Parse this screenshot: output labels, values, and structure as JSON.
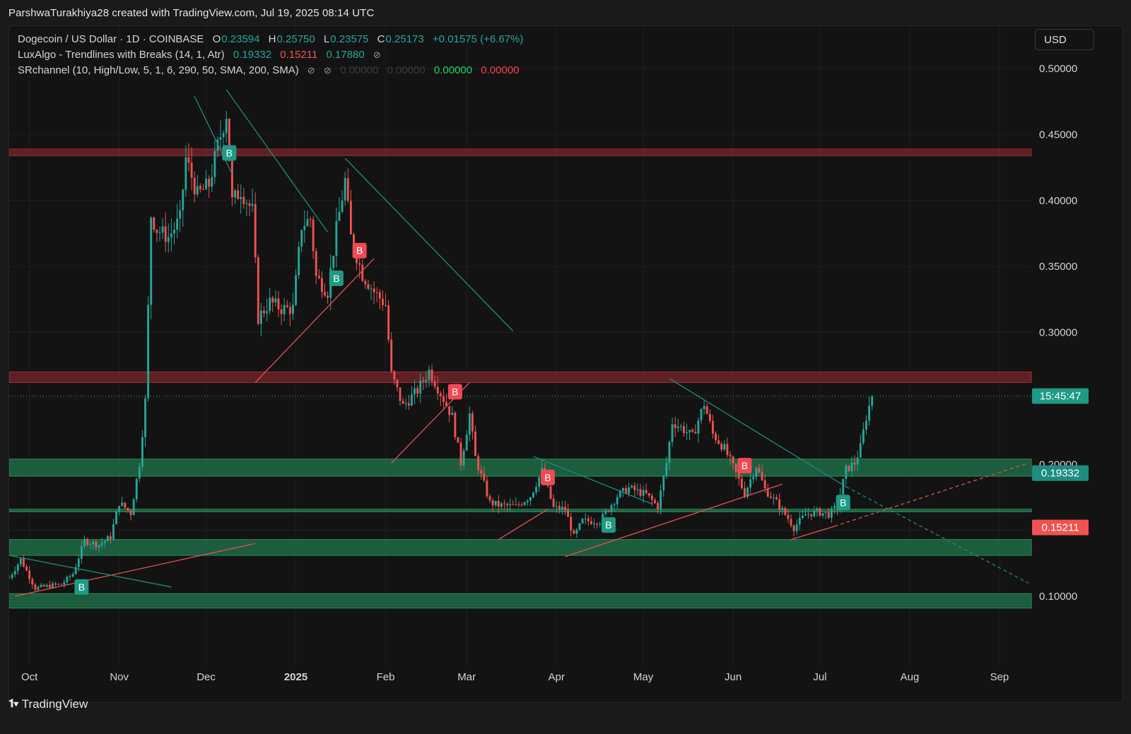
{
  "header": {
    "credit": "ParshwaTurakhiya28 created with TradingView.com, Jul 19, 2025 08:14 UTC"
  },
  "legend": {
    "symbol": "Dogecoin / US Dollar · 1D · COINBASE",
    "open_label": "O",
    "open": "0.23594",
    "high_label": "H",
    "high": "0.25750",
    "low_label": "L",
    "low": "0.23575",
    "close_label": "C",
    "close": "0.25173",
    "change": "+0.01575 (+6.67%)",
    "luxalgo_name": "LuxAlgo - Trendlines with Breaks (14, 1, Atr)",
    "luxalgo_v1": "0.19332",
    "luxalgo_v2": "0.15211",
    "luxalgo_v3": "0.17880",
    "srchannel_name": "SRchannel (10, High/Low, 5, 1, 6, 290, 50, SMA, 200, SMA)",
    "sr_v1": "0.00000",
    "sr_v2": "0.00000",
    "sr_v3": "0.00000",
    "sr_v4": "0.00000",
    "hidden_icon": "eye-off-icon"
  },
  "currency": "USD",
  "footer": {
    "brand": "TradingView",
    "brand_icon": "tradingview-logo-icon"
  },
  "colors": {
    "bg": "#131313",
    "up": "#26a69a",
    "down": "#ef5350",
    "green_zone": "#1f6b45",
    "red_zone": "#6b2328",
    "trend_teal": "#1e8c80"
  },
  "chart_data": {
    "type": "candlestick",
    "symbol": "DOGE/USD",
    "interval": "1D",
    "ylim": [
      0.055,
      0.5
    ],
    "y_ticks": [
      "0.10000",
      "0.15000",
      "0.20000",
      "0.25000",
      "0.30000",
      "0.35000",
      "0.40000",
      "0.45000",
      "0.50000"
    ],
    "x_labels": [
      {
        "label": "Oct",
        "date": "2024-10-01",
        "bold": false
      },
      {
        "label": "Nov",
        "date": "2024-11-01",
        "bold": false
      },
      {
        "label": "Dec",
        "date": "2024-12-01",
        "bold": false
      },
      {
        "label": "2025",
        "date": "2025-01-01",
        "bold": true
      },
      {
        "label": "Feb",
        "date": "2025-02-01",
        "bold": false
      },
      {
        "label": "Mar",
        "date": "2025-03-01",
        "bold": false
      },
      {
        "label": "Apr",
        "date": "2025-04-01",
        "bold": false
      },
      {
        "label": "May",
        "date": "2025-05-01",
        "bold": false
      },
      {
        "label": "Jun",
        "date": "2025-06-01",
        "bold": false
      },
      {
        "label": "Jul",
        "date": "2025-07-01",
        "bold": false
      },
      {
        "label": "Aug",
        "date": "2025-08-01",
        "bold": false
      },
      {
        "label": "Sep",
        "date": "2025-09-01",
        "bold": false
      }
    ],
    "x_range": [
      "2024-09-24",
      "2025-09-12"
    ],
    "last_close": 0.25173,
    "countdown": "15:45:47",
    "price_labels": [
      {
        "value": 0.19332,
        "text": "0.19332",
        "color": "#1e8c80"
      },
      {
        "value": 0.15211,
        "text": "0.15211",
        "color": "#ef5350"
      }
    ],
    "close_series": [
      {
        "date": "2024-09-24",
        "close": 0.114
      },
      {
        "date": "2024-09-28",
        "close": 0.128
      },
      {
        "date": "2024-10-03",
        "close": 0.106
      },
      {
        "date": "2024-10-08",
        "close": 0.108
      },
      {
        "date": "2024-10-12",
        "close": 0.109
      },
      {
        "date": "2024-10-16",
        "close": 0.117
      },
      {
        "date": "2024-10-20",
        "close": 0.142
      },
      {
        "date": "2024-10-25",
        "close": 0.139
      },
      {
        "date": "2024-10-29",
        "close": 0.145
      },
      {
        "date": "2024-11-01",
        "close": 0.171
      },
      {
        "date": "2024-11-05",
        "close": 0.163
      },
      {
        "date": "2024-11-08",
        "close": 0.201
      },
      {
        "date": "2024-11-10",
        "close": 0.248
      },
      {
        "date": "2024-11-12",
        "close": 0.389
      },
      {
        "date": "2024-11-14",
        "close": 0.378
      },
      {
        "date": "2024-11-18",
        "close": 0.372
      },
      {
        "date": "2024-11-22",
        "close": 0.386
      },
      {
        "date": "2024-11-24",
        "close": 0.432
      },
      {
        "date": "2024-11-28",
        "close": 0.404
      },
      {
        "date": "2024-12-02",
        "close": 0.412
      },
      {
        "date": "2024-12-05",
        "close": 0.441
      },
      {
        "date": "2024-12-08",
        "close": 0.466
      },
      {
        "date": "2024-12-10",
        "close": 0.399
      },
      {
        "date": "2024-12-13",
        "close": 0.408
      },
      {
        "date": "2024-12-17",
        "close": 0.392
      },
      {
        "date": "2024-12-19",
        "close": 0.311
      },
      {
        "date": "2024-12-23",
        "close": 0.323
      },
      {
        "date": "2024-12-27",
        "close": 0.318
      },
      {
        "date": "2024-12-31",
        "close": 0.318
      },
      {
        "date": "2025-01-03",
        "close": 0.381
      },
      {
        "date": "2025-01-06",
        "close": 0.386
      },
      {
        "date": "2025-01-08",
        "close": 0.342
      },
      {
        "date": "2025-01-12",
        "close": 0.331
      },
      {
        "date": "2025-01-15",
        "close": 0.378
      },
      {
        "date": "2025-01-18",
        "close": 0.415
      },
      {
        "date": "2025-01-20",
        "close": 0.372
      },
      {
        "date": "2025-01-24",
        "close": 0.344
      },
      {
        "date": "2025-01-28",
        "close": 0.331
      },
      {
        "date": "2025-02-01",
        "close": 0.321
      },
      {
        "date": "2025-02-03",
        "close": 0.268
      },
      {
        "date": "2025-02-07",
        "close": 0.244
      },
      {
        "date": "2025-02-12",
        "close": 0.256
      },
      {
        "date": "2025-02-16",
        "close": 0.271
      },
      {
        "date": "2025-02-20",
        "close": 0.254
      },
      {
        "date": "2025-02-24",
        "close": 0.236
      },
      {
        "date": "2025-02-27",
        "close": 0.201
      },
      {
        "date": "2025-03-02",
        "close": 0.238
      },
      {
        "date": "2025-03-04",
        "close": 0.205
      },
      {
        "date": "2025-03-09",
        "close": 0.171
      },
      {
        "date": "2025-03-12",
        "close": 0.169
      },
      {
        "date": "2025-03-18",
        "close": 0.168
      },
      {
        "date": "2025-03-23",
        "close": 0.176
      },
      {
        "date": "2025-03-27",
        "close": 0.195
      },
      {
        "date": "2025-03-31",
        "close": 0.167
      },
      {
        "date": "2025-04-04",
        "close": 0.166
      },
      {
        "date": "2025-04-07",
        "close": 0.145
      },
      {
        "date": "2025-04-10",
        "close": 0.157
      },
      {
        "date": "2025-04-16",
        "close": 0.157
      },
      {
        "date": "2025-04-22",
        "close": 0.176
      },
      {
        "date": "2025-04-26",
        "close": 0.182
      },
      {
        "date": "2025-05-02",
        "close": 0.177
      },
      {
        "date": "2025-05-06",
        "close": 0.168
      },
      {
        "date": "2025-05-09",
        "close": 0.201
      },
      {
        "date": "2025-05-11",
        "close": 0.232
      },
      {
        "date": "2025-05-14",
        "close": 0.228
      },
      {
        "date": "2025-05-18",
        "close": 0.221
      },
      {
        "date": "2025-05-22",
        "close": 0.246
      },
      {
        "date": "2025-05-25",
        "close": 0.223
      },
      {
        "date": "2025-05-29",
        "close": 0.212
      },
      {
        "date": "2025-06-02",
        "close": 0.193
      },
      {
        "date": "2025-06-05",
        "close": 0.178
      },
      {
        "date": "2025-06-09",
        "close": 0.199
      },
      {
        "date": "2025-06-12",
        "close": 0.181
      },
      {
        "date": "2025-06-16",
        "close": 0.171
      },
      {
        "date": "2025-06-20",
        "close": 0.159
      },
      {
        "date": "2025-06-22",
        "close": 0.152
      },
      {
        "date": "2025-06-26",
        "close": 0.162
      },
      {
        "date": "2025-06-30",
        "close": 0.164
      },
      {
        "date": "2025-07-04",
        "close": 0.162
      },
      {
        "date": "2025-07-07",
        "close": 0.168
      },
      {
        "date": "2025-07-10",
        "close": 0.196
      },
      {
        "date": "2025-07-13",
        "close": 0.201
      },
      {
        "date": "2025-07-15",
        "close": 0.213
      },
      {
        "date": "2025-07-17",
        "close": 0.236
      },
      {
        "date": "2025-07-19",
        "close": 0.252
      }
    ],
    "zones": [
      {
        "type": "resistance",
        "from": 0.434,
        "to": 0.439
      },
      {
        "type": "resistance",
        "from": 0.262,
        "to": 0.27
      },
      {
        "type": "support",
        "from": 0.191,
        "to": 0.204
      },
      {
        "type": "support",
        "from": 0.164,
        "to": 0.166
      },
      {
        "type": "support",
        "from": 0.131,
        "to": 0.143
      },
      {
        "type": "support",
        "from": 0.091,
        "to": 0.102
      }
    ],
    "trendlines": [
      {
        "color": "teal",
        "dashed": false,
        "from": [
          "2024-11-27",
          0.479
        ],
        "to": [
          "2024-12-10",
          0.42
        ]
      },
      {
        "color": "teal",
        "dashed": false,
        "from": [
          "2024-12-08",
          0.484
        ],
        "to": [
          "2025-01-12",
          0.376
        ]
      },
      {
        "color": "teal",
        "dashed": false,
        "from": [
          "2025-01-18",
          0.432
        ],
        "to": [
          "2025-03-17",
          0.301
        ]
      },
      {
        "color": "red",
        "dashed": false,
        "from": [
          "2024-12-18",
          0.262
        ],
        "to": [
          "2025-01-28",
          0.356
        ]
      },
      {
        "color": "red",
        "dashed": false,
        "from": [
          "2025-02-03",
          0.201
        ],
        "to": [
          "2025-03-02",
          0.262
        ]
      },
      {
        "color": "red",
        "dashed": false,
        "from": [
          "2024-09-26",
          0.1
        ],
        "to": [
          "2024-12-18",
          0.14
        ]
      },
      {
        "color": "teal",
        "dashed": false,
        "from": [
          "2024-09-24",
          0.131
        ],
        "to": [
          "2024-11-19",
          0.107
        ]
      },
      {
        "color": "teal",
        "dashed": false,
        "from": [
          "2025-03-24",
          0.206
        ],
        "to": [
          "2025-05-04",
          0.17
        ]
      },
      {
        "color": "red",
        "dashed": false,
        "from": [
          "2025-03-12",
          0.143
        ],
        "to": [
          "2025-03-29",
          0.166
        ]
      },
      {
        "color": "red",
        "dashed": false,
        "from": [
          "2025-04-04",
          0.13
        ],
        "to": [
          "2025-06-18",
          0.185
        ]
      },
      {
        "color": "teal",
        "dashed": false,
        "from": [
          "2025-05-10",
          0.265
        ],
        "to": [
          "2025-07-10",
          0.183
        ]
      },
      {
        "color": "teal",
        "dashed": true,
        "from": [
          "2025-07-10",
          0.183
        ],
        "to": [
          "2025-09-11",
          0.11
        ]
      },
      {
        "color": "red",
        "dashed": false,
        "from": [
          "2025-06-21",
          0.143
        ],
        "to": [
          "2025-07-06",
          0.153
        ]
      },
      {
        "color": "red",
        "dashed": true,
        "from": [
          "2025-07-06",
          0.153
        ],
        "to": [
          "2025-09-11",
          0.201
        ]
      }
    ],
    "breaks": [
      {
        "label": "B",
        "type": "bullish",
        "date": "2024-10-19",
        "price": 0.107
      },
      {
        "label": "B",
        "type": "bullish",
        "date": "2024-12-09",
        "price": 0.436
      },
      {
        "label": "B",
        "type": "bearish",
        "date": "2025-01-23",
        "price": 0.362
      },
      {
        "label": "B",
        "type": "bullish",
        "date": "2025-01-15",
        "price": 0.341
      },
      {
        "label": "B",
        "type": "bearish",
        "date": "2025-02-25",
        "price": 0.255
      },
      {
        "label": "B",
        "type": "bearish",
        "date": "2025-03-29",
        "price": 0.19
      },
      {
        "label": "B",
        "type": "bullish",
        "date": "2025-04-19",
        "price": 0.154
      },
      {
        "label": "B",
        "type": "bearish",
        "date": "2025-06-05",
        "price": 0.199
      },
      {
        "label": "B",
        "type": "bullish",
        "date": "2025-07-09",
        "price": 0.171
      }
    ]
  }
}
